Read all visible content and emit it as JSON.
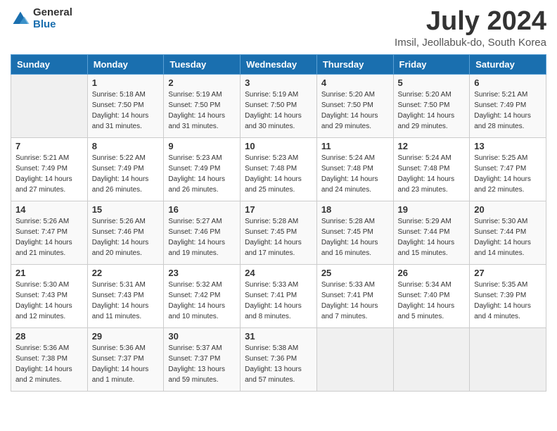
{
  "logo": {
    "general": "General",
    "blue": "Blue"
  },
  "title": "July 2024",
  "subtitle": "Imsil, Jeollabuk-do, South Korea",
  "headers": [
    "Sunday",
    "Monday",
    "Tuesday",
    "Wednesday",
    "Thursday",
    "Friday",
    "Saturday"
  ],
  "weeks": [
    [
      {
        "day": "",
        "info": ""
      },
      {
        "day": "1",
        "info": "Sunrise: 5:18 AM\nSunset: 7:50 PM\nDaylight: 14 hours\nand 31 minutes."
      },
      {
        "day": "2",
        "info": "Sunrise: 5:19 AM\nSunset: 7:50 PM\nDaylight: 14 hours\nand 31 minutes."
      },
      {
        "day": "3",
        "info": "Sunrise: 5:19 AM\nSunset: 7:50 PM\nDaylight: 14 hours\nand 30 minutes."
      },
      {
        "day": "4",
        "info": "Sunrise: 5:20 AM\nSunset: 7:50 PM\nDaylight: 14 hours\nand 29 minutes."
      },
      {
        "day": "5",
        "info": "Sunrise: 5:20 AM\nSunset: 7:50 PM\nDaylight: 14 hours\nand 29 minutes."
      },
      {
        "day": "6",
        "info": "Sunrise: 5:21 AM\nSunset: 7:49 PM\nDaylight: 14 hours\nand 28 minutes."
      }
    ],
    [
      {
        "day": "7",
        "info": "Sunrise: 5:21 AM\nSunset: 7:49 PM\nDaylight: 14 hours\nand 27 minutes."
      },
      {
        "day": "8",
        "info": "Sunrise: 5:22 AM\nSunset: 7:49 PM\nDaylight: 14 hours\nand 26 minutes."
      },
      {
        "day": "9",
        "info": "Sunrise: 5:23 AM\nSunset: 7:49 PM\nDaylight: 14 hours\nand 26 minutes."
      },
      {
        "day": "10",
        "info": "Sunrise: 5:23 AM\nSunset: 7:48 PM\nDaylight: 14 hours\nand 25 minutes."
      },
      {
        "day": "11",
        "info": "Sunrise: 5:24 AM\nSunset: 7:48 PM\nDaylight: 14 hours\nand 24 minutes."
      },
      {
        "day": "12",
        "info": "Sunrise: 5:24 AM\nSunset: 7:48 PM\nDaylight: 14 hours\nand 23 minutes."
      },
      {
        "day": "13",
        "info": "Sunrise: 5:25 AM\nSunset: 7:47 PM\nDaylight: 14 hours\nand 22 minutes."
      }
    ],
    [
      {
        "day": "14",
        "info": "Sunrise: 5:26 AM\nSunset: 7:47 PM\nDaylight: 14 hours\nand 21 minutes."
      },
      {
        "day": "15",
        "info": "Sunrise: 5:26 AM\nSunset: 7:46 PM\nDaylight: 14 hours\nand 20 minutes."
      },
      {
        "day": "16",
        "info": "Sunrise: 5:27 AM\nSunset: 7:46 PM\nDaylight: 14 hours\nand 19 minutes."
      },
      {
        "day": "17",
        "info": "Sunrise: 5:28 AM\nSunset: 7:45 PM\nDaylight: 14 hours\nand 17 minutes."
      },
      {
        "day": "18",
        "info": "Sunrise: 5:28 AM\nSunset: 7:45 PM\nDaylight: 14 hours\nand 16 minutes."
      },
      {
        "day": "19",
        "info": "Sunrise: 5:29 AM\nSunset: 7:44 PM\nDaylight: 14 hours\nand 15 minutes."
      },
      {
        "day": "20",
        "info": "Sunrise: 5:30 AM\nSunset: 7:44 PM\nDaylight: 14 hours\nand 14 minutes."
      }
    ],
    [
      {
        "day": "21",
        "info": "Sunrise: 5:30 AM\nSunset: 7:43 PM\nDaylight: 14 hours\nand 12 minutes."
      },
      {
        "day": "22",
        "info": "Sunrise: 5:31 AM\nSunset: 7:43 PM\nDaylight: 14 hours\nand 11 minutes."
      },
      {
        "day": "23",
        "info": "Sunrise: 5:32 AM\nSunset: 7:42 PM\nDaylight: 14 hours\nand 10 minutes."
      },
      {
        "day": "24",
        "info": "Sunrise: 5:33 AM\nSunset: 7:41 PM\nDaylight: 14 hours\nand 8 minutes."
      },
      {
        "day": "25",
        "info": "Sunrise: 5:33 AM\nSunset: 7:41 PM\nDaylight: 14 hours\nand 7 minutes."
      },
      {
        "day": "26",
        "info": "Sunrise: 5:34 AM\nSunset: 7:40 PM\nDaylight: 14 hours\nand 5 minutes."
      },
      {
        "day": "27",
        "info": "Sunrise: 5:35 AM\nSunset: 7:39 PM\nDaylight: 14 hours\nand 4 minutes."
      }
    ],
    [
      {
        "day": "28",
        "info": "Sunrise: 5:36 AM\nSunset: 7:38 PM\nDaylight: 14 hours\nand 2 minutes."
      },
      {
        "day": "29",
        "info": "Sunrise: 5:36 AM\nSunset: 7:37 PM\nDaylight: 14 hours\nand 1 minute."
      },
      {
        "day": "30",
        "info": "Sunrise: 5:37 AM\nSunset: 7:37 PM\nDaylight: 13 hours\nand 59 minutes."
      },
      {
        "day": "31",
        "info": "Sunrise: 5:38 AM\nSunset: 7:36 PM\nDaylight: 13 hours\nand 57 minutes."
      },
      {
        "day": "",
        "info": ""
      },
      {
        "day": "",
        "info": ""
      },
      {
        "day": "",
        "info": ""
      }
    ]
  ]
}
